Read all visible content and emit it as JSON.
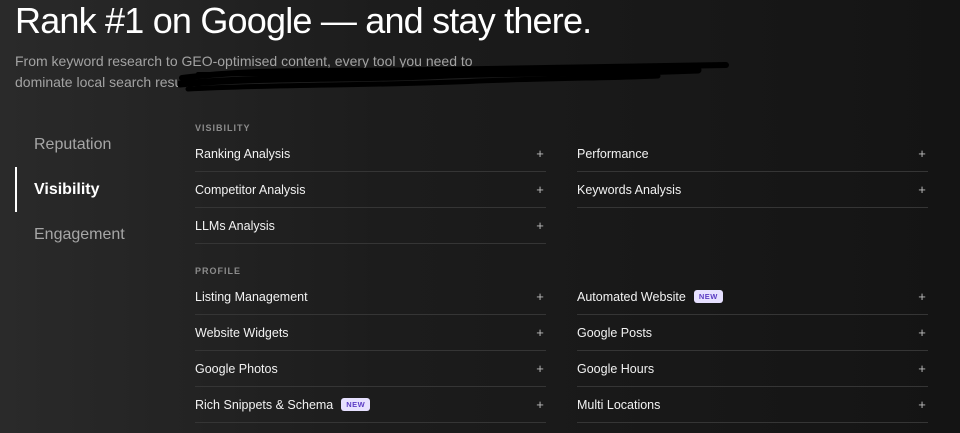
{
  "hero": {
    "title": "Rank #1 on Google — and stay there.",
    "subtitle": "From keyword research to GEO-optimised content, every tool you need to dominate local search results"
  },
  "nav": {
    "items": [
      {
        "label": "Reputation",
        "active": false
      },
      {
        "label": "Visibility",
        "active": true
      },
      {
        "label": "Engagement",
        "active": false
      }
    ]
  },
  "sections": {
    "visibility": {
      "label": "VISIBILITY",
      "left": [
        {
          "label": "Ranking Analysis"
        },
        {
          "label": "Competitor Analysis"
        },
        {
          "label": "LLMs Analysis"
        }
      ],
      "right": [
        {
          "label": "Performance"
        },
        {
          "label": "Keywords Analysis"
        }
      ]
    },
    "profile": {
      "label": "PROFILE",
      "left": [
        {
          "label": "Listing Management"
        },
        {
          "label": "Website Widgets"
        },
        {
          "label": "Google Photos"
        },
        {
          "label": "Rich Snippets & Schema",
          "badge": "NEW"
        }
      ],
      "right": [
        {
          "label": "Automated Website",
          "badge": "NEW"
        },
        {
          "label": "Google Posts"
        },
        {
          "label": "Google Hours"
        },
        {
          "label": "Multi Locations"
        }
      ]
    }
  },
  "icons": {
    "expand": "plus-icon",
    "expand_glyph": "+"
  },
  "colors": {
    "badge_bg": "#e6e0ff",
    "badge_text": "#5b3cc4",
    "background": "#1c1c1c"
  }
}
